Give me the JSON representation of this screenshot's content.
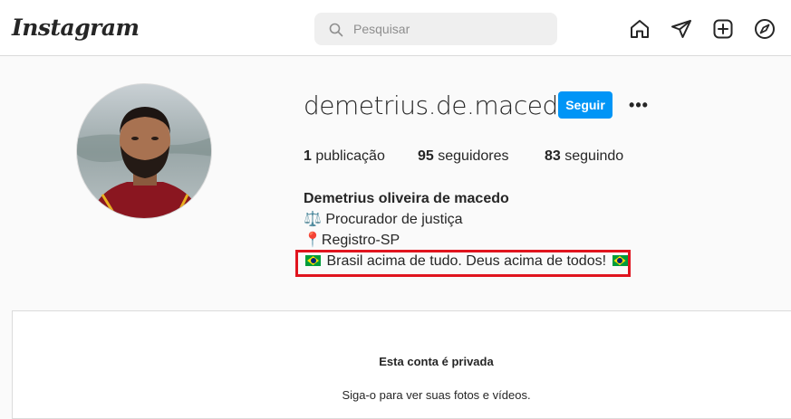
{
  "header": {
    "logo_text": "Instagram",
    "search": {
      "placeholder": "Pesquisar",
      "icon": "search-icon"
    },
    "nav_icons": [
      "home-icon",
      "direct-send-icon",
      "new-post-icon",
      "explore-compass-icon"
    ]
  },
  "profile": {
    "username": "demetrius.de.macedo",
    "follow_label": "Seguir",
    "more_label": "•••",
    "stats": {
      "posts_count": "1",
      "posts_label": " publicação",
      "followers_count": "95",
      "followers_label": " seguidores",
      "following_count": "83",
      "following_label": " seguindo"
    },
    "bio": {
      "full_name": "Demetrius oliveira de macedo",
      "line1_emoji": "⚖️",
      "line1": " Procurador de justiça",
      "line2_emoji": "📍",
      "line2": "Registro-SP",
      "line3": " Brasil acima de tudo. Deus acima de todos! "
    }
  },
  "private_notice": {
    "title": "Esta conta é privada",
    "subtitle": "Siga-o para ver suas fotos e vídeos."
  },
  "colors": {
    "accent_blue": "#0095f6",
    "highlight_red": "#e0141e",
    "border": "#dbdbdb",
    "background": "#fafafa"
  }
}
